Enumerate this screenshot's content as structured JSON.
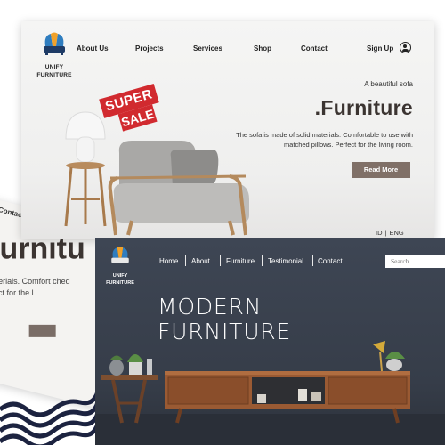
{
  "brand": {
    "name_line1": "UNIFY",
    "name_line2": "FURNITURE"
  },
  "top_site": {
    "nav": [
      "About Us",
      "Projects",
      "Services",
      "Shop",
      "Contact"
    ],
    "signup_label": "Sign Up",
    "sale_badge": {
      "line1": "SUPER",
      "line2": "SALE"
    },
    "tagline": "A beautiful sofa",
    "title": ".Furniture",
    "description": "The sofa is made of solid materials. Comfortable to use with matched pillows. Perfect for the living room.",
    "cta_label": "Read More",
    "languages": [
      "ID",
      "ENG"
    ],
    "colors": {
      "button": "#807067",
      "title": "#3b3431",
      "sale": "#d12a2f"
    }
  },
  "back_site": {
    "nav_fragment": "Contact",
    "title_fragment": ".Furnitu",
    "description_fragment": "e of solid materials. Comfort ched pillows. Perfect for the l"
  },
  "bottom_site": {
    "nav": [
      "Home",
      "About",
      "Furniture",
      "Testimonial",
      "Contact"
    ],
    "search_placeholder": "Search",
    "headline_line1": "MODERN",
    "headline_line2": "FURNITURE",
    "colors": {
      "background": "#3e4654",
      "cabinet": "#9a5a33"
    }
  },
  "icons": {
    "user": "user-circle-icon",
    "logo": "sofa-logo-icon"
  }
}
